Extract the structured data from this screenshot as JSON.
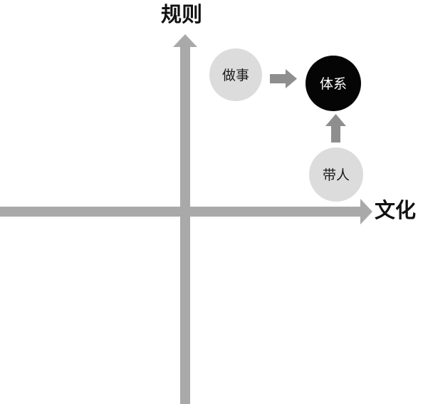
{
  "axes": {
    "y_label": "规则",
    "x_label": "文化"
  },
  "nodes": [
    {
      "id": "doing",
      "label": "做事",
      "fill": "#dcdcdc",
      "text_color": "#1a1a1a"
    },
    {
      "id": "system",
      "label": "体系",
      "fill": "#050505",
      "text_color": "#ffffff"
    },
    {
      "id": "leading",
      "label": "带人",
      "fill": "#dcdcdc",
      "text_color": "#1a1a1a"
    }
  ],
  "edges": [
    {
      "from": "doing",
      "to": "system"
    },
    {
      "from": "leading",
      "to": "system"
    }
  ],
  "colors": {
    "axis": "#a9a9a9",
    "arrow": "#8e8e8e"
  }
}
